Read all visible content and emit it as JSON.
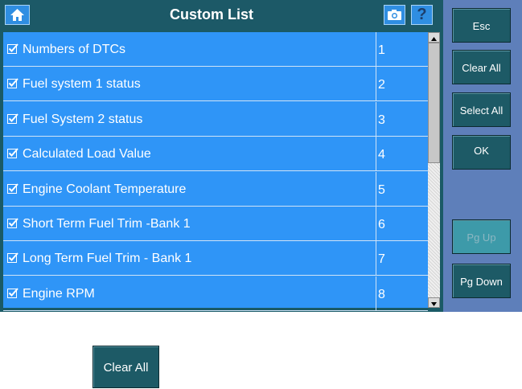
{
  "header": {
    "title": "Custom List",
    "icons": [
      "home-icon",
      "camera-icon",
      "help-icon"
    ],
    "help_label": "?"
  },
  "list": {
    "rows": [
      {
        "label": "Numbers of DTCs",
        "number": "1",
        "checked": true
      },
      {
        "label": "Fuel system 1 status",
        "number": "2",
        "checked": true
      },
      {
        "label": "Fuel System 2 status",
        "number": "3",
        "checked": true
      },
      {
        "label": "Calculated Load Value",
        "number": "4",
        "checked": true
      },
      {
        "label": "Engine Coolant Temperature",
        "number": "5",
        "checked": true
      },
      {
        "label": "Short Term Fuel Trim -Bank 1",
        "number": "6",
        "checked": true
      },
      {
        "label": "Long Term Fuel Trim - Bank 1",
        "number": "7",
        "checked": true
      },
      {
        "label": "Engine RPM",
        "number": "8",
        "checked": true
      }
    ]
  },
  "sidebar": {
    "esc": "Esc",
    "clear_all": "Clear All",
    "select_all": "Select All",
    "ok": "OK",
    "pg_up": "Pg Up",
    "pg_down": "Pg Down"
  },
  "bottom": {
    "clear_all": "Clear All"
  },
  "colors": {
    "list_bg": "#2f95f7",
    "header_bg": "#1c5967",
    "button_bg": "#1d5a66",
    "side_panel_bg": "#5e7fba"
  }
}
